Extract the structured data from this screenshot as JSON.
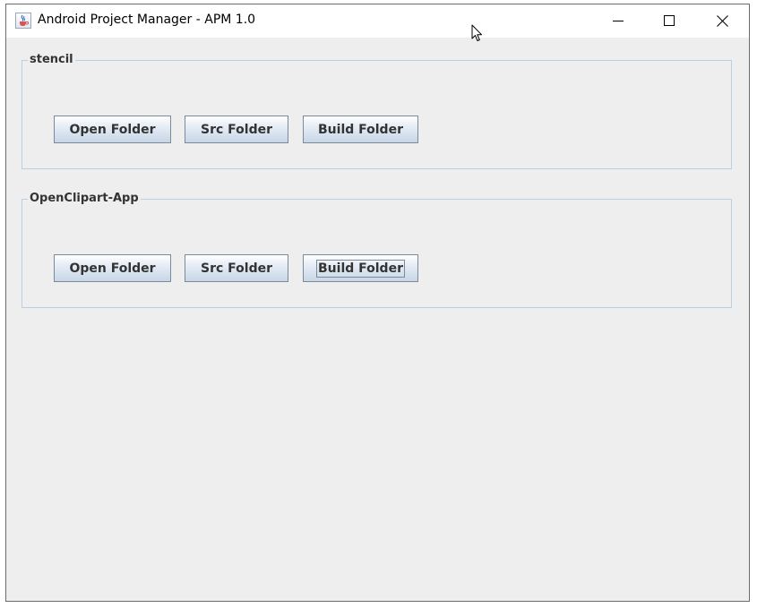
{
  "window": {
    "title": "Android Project Manager - APM 1.0"
  },
  "projects": [
    {
      "name": "stencil",
      "buttons": {
        "open": "Open Folder",
        "src": "Src Folder",
        "build": "Build Folder"
      }
    },
    {
      "name": "OpenClipart-App",
      "buttons": {
        "open": "Open Folder",
        "src": "Src Folder",
        "build": "Build Folder"
      }
    }
  ],
  "icons": {
    "app": "java-coffee-icon",
    "minimize": "minimize-icon",
    "maximize": "maximize-icon",
    "close": "close-icon",
    "cursor": "mouse-pointer-icon"
  },
  "colors": {
    "panel_border": "#b8cfe5",
    "window_bg": "#eeeeee",
    "button_text": "#333333"
  }
}
